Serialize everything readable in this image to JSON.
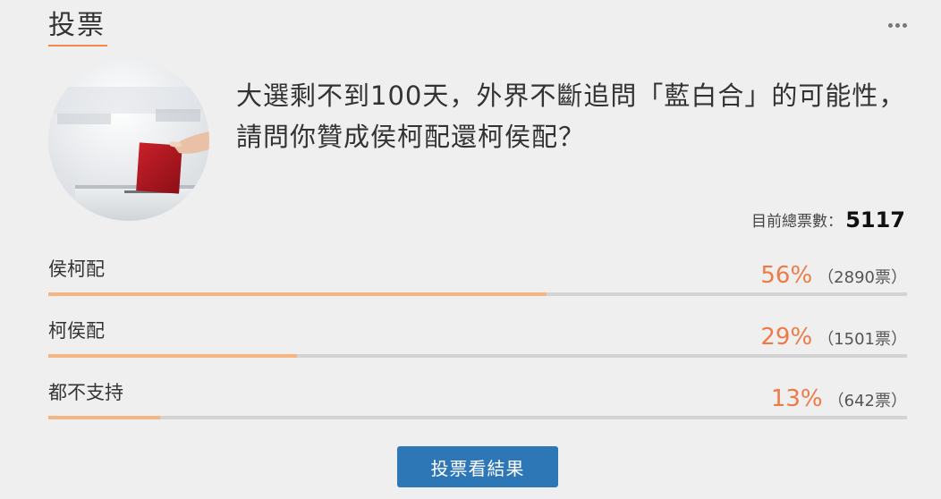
{
  "header": {
    "title": "投票",
    "menu_icon": "more-dots-icon"
  },
  "poll": {
    "image": "ballot-box-hand-image",
    "question": "大選剩不到100天，外界不斷追問「藍白合」的可能性，請問你贊成侯柯配還柯侯配？",
    "total_label": "目前總票數：",
    "total_votes": "5117",
    "options": [
      {
        "label": "侯柯配",
        "percent_text": "56%",
        "count_text": "（2890票）",
        "fraction": 0.58
      },
      {
        "label": "柯侯配",
        "percent_text": "29%",
        "count_text": "（1501票）",
        "fraction": 0.29
      },
      {
        "label": "都不支持",
        "percent_text": "13%",
        "count_text": "（642票）",
        "fraction": 0.13
      }
    ],
    "result_button": "投票看結果"
  },
  "colors": {
    "accent": "#f08a4b",
    "percent": "#ee7a45",
    "bar_fill": "#f4b583",
    "bar_track": "#d3d3d3",
    "button": "#2e77b7"
  }
}
